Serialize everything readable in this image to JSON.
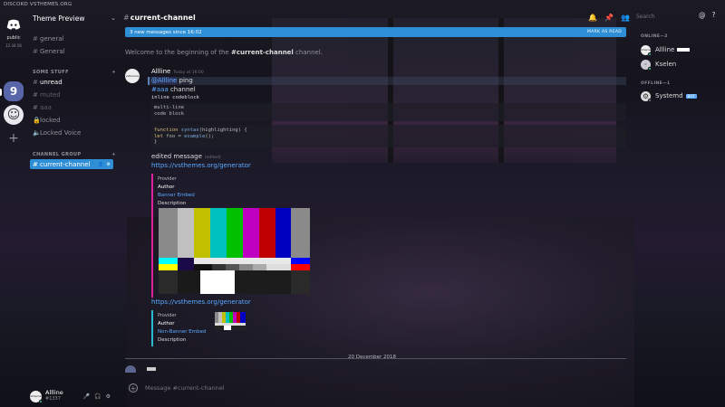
{
  "window": {
    "title": "DISCORD VSTHEMES.ORG"
  },
  "servers": {
    "home_icon": "discord-logo-icon",
    "labels": [
      "public",
      "12.34.56"
    ],
    "items": [
      {
        "label": "9",
        "icon": "server-9-icon"
      },
      {
        "label": "☺",
        "icon": "ghost-server-icon"
      },
      {
        "label": "+",
        "icon": "add-server-icon"
      }
    ]
  },
  "sidebar": {
    "guild_name": "Theme Preview",
    "top_channels": [
      {
        "name": "general",
        "state": "normal"
      },
      {
        "name": "General",
        "state": "normal"
      }
    ],
    "category1": {
      "label": "SOME STUFF",
      "action": "+"
    },
    "cat1_channels": [
      {
        "name": "unread",
        "state": "unread"
      },
      {
        "name": "muted",
        "state": "muted"
      },
      {
        "name": "aaa",
        "state": "muted"
      },
      {
        "name": "locked",
        "state": "normal"
      },
      {
        "name": "Locked Voice",
        "state": "normal"
      }
    ],
    "category2": {
      "label": "CHANNEL GROUP",
      "action": "+"
    },
    "selected_channel": {
      "name": "current-channel"
    }
  },
  "user_panel": {
    "name": "Allline",
    "tag": "#1337",
    "avatar_text": "vsthemes"
  },
  "header": {
    "channel": "current-channel",
    "search_placeholder": "Search"
  },
  "chat": {
    "new_messages": "3 new messages since 16:02",
    "mark_as_read": "MARK AS READ",
    "welcome_prefix": "Welcome to the beginning of the ",
    "welcome_channel": "#current-channel",
    "welcome_suffix": " channel.",
    "message": {
      "author": "Allline",
      "timestamp": "Today at 16:00",
      "avatar_text": "vsthemes",
      "mention": "@Allline",
      "mention_text": " ping",
      "channel_mention": "#aaa",
      "channel_text": " channel",
      "inline_code": "inline codeblock",
      "code_block": [
        "multi-line",
        "code block"
      ],
      "code_fn": [
        "function",
        " syntax",
        "(highlighting) {"
      ],
      "code_body": [
        "  let",
        " foo = ",
        "example",
        "();"
      ],
      "code_end": "}",
      "edited_text": "edited message",
      "edited_ts": "(edited)",
      "link1": "https://vsthemes.org/generator",
      "link2": "https://vsthemes.org/generator"
    },
    "embed1": {
      "provider": "Provider",
      "author": "Author",
      "title": "Banner Embed",
      "description": "Description"
    },
    "embed2": {
      "provider": "Provider",
      "author": "Author",
      "title": "Non-Banner Embed",
      "description": "Description"
    },
    "divider_date": "20 December 2018",
    "composer_placeholder": "Message #current-channel"
  },
  "members": {
    "online_label": "ONLINE—2",
    "offline_label": "OFFLINE—1",
    "online": [
      {
        "name": "Allline",
        "avatar_text": "vsthemes",
        "status_color": "#43b581",
        "tag": "  "
      },
      {
        "name": "Kselen",
        "avatar_text": "K",
        "status_color": "#43b581"
      }
    ],
    "offline": [
      {
        "name": "Systemd",
        "avatar_text": "⚙",
        "status_color": "#747f8d",
        "badge": "BOT"
      }
    ]
  },
  "colors": {
    "accent": "#2f8fd6",
    "link": "#5aa9ff",
    "embed1_border": "#e0219c",
    "embed2_border": "#2abbd4",
    "online": "#43b581"
  }
}
